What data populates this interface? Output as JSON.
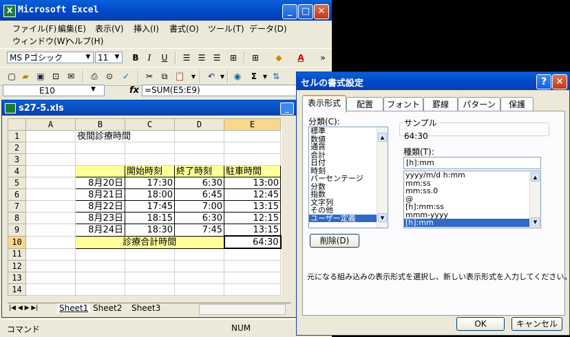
{
  "excel": {
    "title": "Microsoft Excel",
    "app_icon": "X",
    "caption": {
      "minimize": "_",
      "maximize": "□",
      "close": "✕"
    },
    "menu_row1": [
      "ファイル(F)",
      "編集(E)",
      "表示(V)",
      "挿入(I)",
      "書式(O)",
      "ツール(T)",
      "データ(D)"
    ],
    "menu_row2": [
      "ウィンドウ(W)",
      "ヘルプ(H)"
    ],
    "font_name": "MS Pゴシック",
    "font_size": "11",
    "toolbar_glyphs": {
      "bold": "B",
      "italic": "I",
      "underline": "U",
      "sum": "Σ",
      "font_color": "A",
      "more": "»"
    },
    "name_box": "E10",
    "fx": "fx",
    "formula": "=SUM(E5:E9)",
    "status_left": "コマンド",
    "status_num": "NUM"
  },
  "workbook": {
    "title": "s27-5.xls",
    "columns": [
      "A",
      "B",
      "C",
      "D",
      "E"
    ],
    "row_numbers": [
      "1",
      "2",
      "3",
      "4",
      "5",
      "6",
      "7",
      "8",
      "9",
      "10",
      "11",
      "12",
      "13",
      "14"
    ],
    "title_cell": "夜間診療時間",
    "headers": [
      "開始時刻",
      "終了時刻",
      "駐車時間"
    ],
    "rows": [
      {
        "date": "8月20日",
        "start": "17:30",
        "end": "6:30",
        "park": "13:00"
      },
      {
        "date": "8月21日",
        "start": "18:00",
        "end": "6:45",
        "park": "12:45"
      },
      {
        "date": "8月22日",
        "start": "17:45",
        "end": "7:00",
        "park": "13:15"
      },
      {
        "date": "8月23日",
        "start": "18:15",
        "end": "6:30",
        "park": "12:15"
      },
      {
        "date": "8月24日",
        "start": "18:30",
        "end": "7:45",
        "park": "13:15"
      }
    ],
    "total_label": "診療合計時間",
    "total_value": "64:30",
    "sheet_nav": "|◀ ◀ ▶ ▶|",
    "sheets": [
      "Sheet1",
      "Sheet2",
      "Sheet3"
    ]
  },
  "dialog": {
    "title": "セルの書式設定",
    "help": "?",
    "close": "✕",
    "tabs": [
      "表示形式",
      "配置",
      "フォント",
      "罫線",
      "パターン",
      "保護"
    ],
    "category_label": "分類(C):",
    "categories": [
      "標準",
      "数値",
      "通貨",
      "会計",
      "日付",
      "時刻",
      "パーセンテージ",
      "分数",
      "指数",
      "文字列",
      "その他",
      "ユーザー定義"
    ],
    "sample_label": "サンプル",
    "sample_value": "64:30",
    "type_label": "種類(T):",
    "type_value": "[h]:mm",
    "types": [
      "yyyy/m/d h:mm",
      "mm:ss",
      "mm:ss.0",
      "@",
      "[h]:mm:ss",
      "mmm-yyyy",
      "[h]:mm"
    ],
    "delete_button": "削除(D)",
    "description": "元になる組み込みの表示形式を選択し、新しい表示形式を入力してください。",
    "ok": "OK",
    "cancel": "キャンセル"
  }
}
